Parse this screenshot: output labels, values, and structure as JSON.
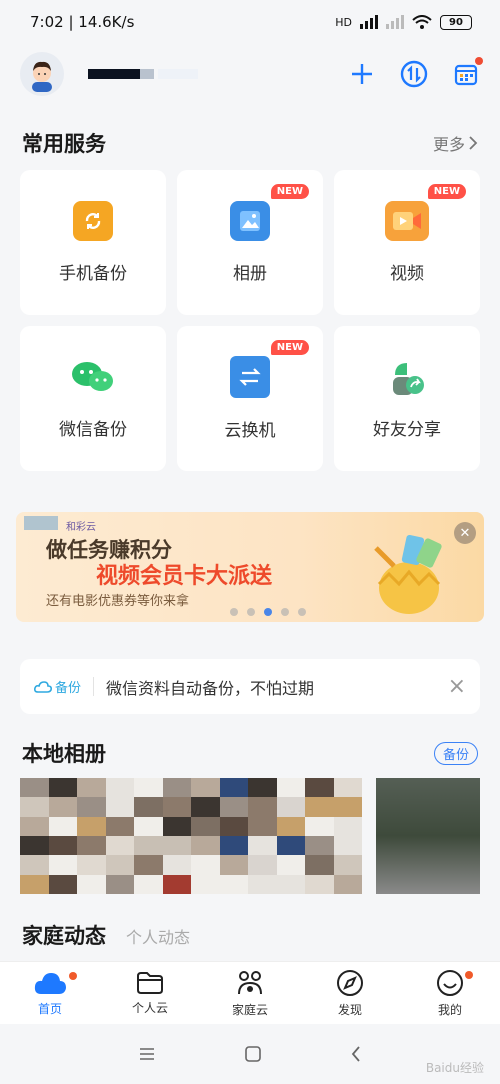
{
  "status": {
    "time_speed": "7:02 | 14.6K/s",
    "network": "HD",
    "battery": "90"
  },
  "header": {
    "add_icon": "plus-icon",
    "transfer_icon": "transfer-icon",
    "calendar_icon": "calendar-icon"
  },
  "services": {
    "title": "常用服务",
    "more": "更多",
    "items": [
      {
        "label": "手机备份",
        "color": "#f5a623",
        "new": ""
      },
      {
        "label": "相册",
        "color": "#3a8ee6",
        "new": "NEW"
      },
      {
        "label": "视频",
        "color": "#f7a23b",
        "new": "NEW"
      },
      {
        "label": "微信备份",
        "color": "#2bc06a",
        "new": ""
      },
      {
        "label": "云换机",
        "color": "#3a8ee6",
        "new": "NEW"
      },
      {
        "label": "好友分享",
        "color": "#3cbf7a",
        "new": ""
      }
    ]
  },
  "banner": {
    "brand": "和彩云",
    "line1": "做任务赚积分",
    "line2": "视频会员卡大派送",
    "line3": "还有电影优惠券等你来拿",
    "close": "✕"
  },
  "notice": {
    "tag": "备份",
    "text": "微信资料自动备份，不怕过期",
    "close": "×"
  },
  "album": {
    "title": "本地相册",
    "backup": "备份"
  },
  "feed": {
    "active": "家庭动态",
    "other": "个人动态"
  },
  "nav": [
    {
      "label": "首页",
      "icon": "cloud-icon"
    },
    {
      "label": "个人云",
      "icon": "folder-icon"
    },
    {
      "label": "家庭云",
      "icon": "family-icon"
    },
    {
      "label": "发现",
      "icon": "compass-icon"
    },
    {
      "label": "我的",
      "icon": "smile-icon"
    }
  ],
  "watermark": "Baidu经验"
}
